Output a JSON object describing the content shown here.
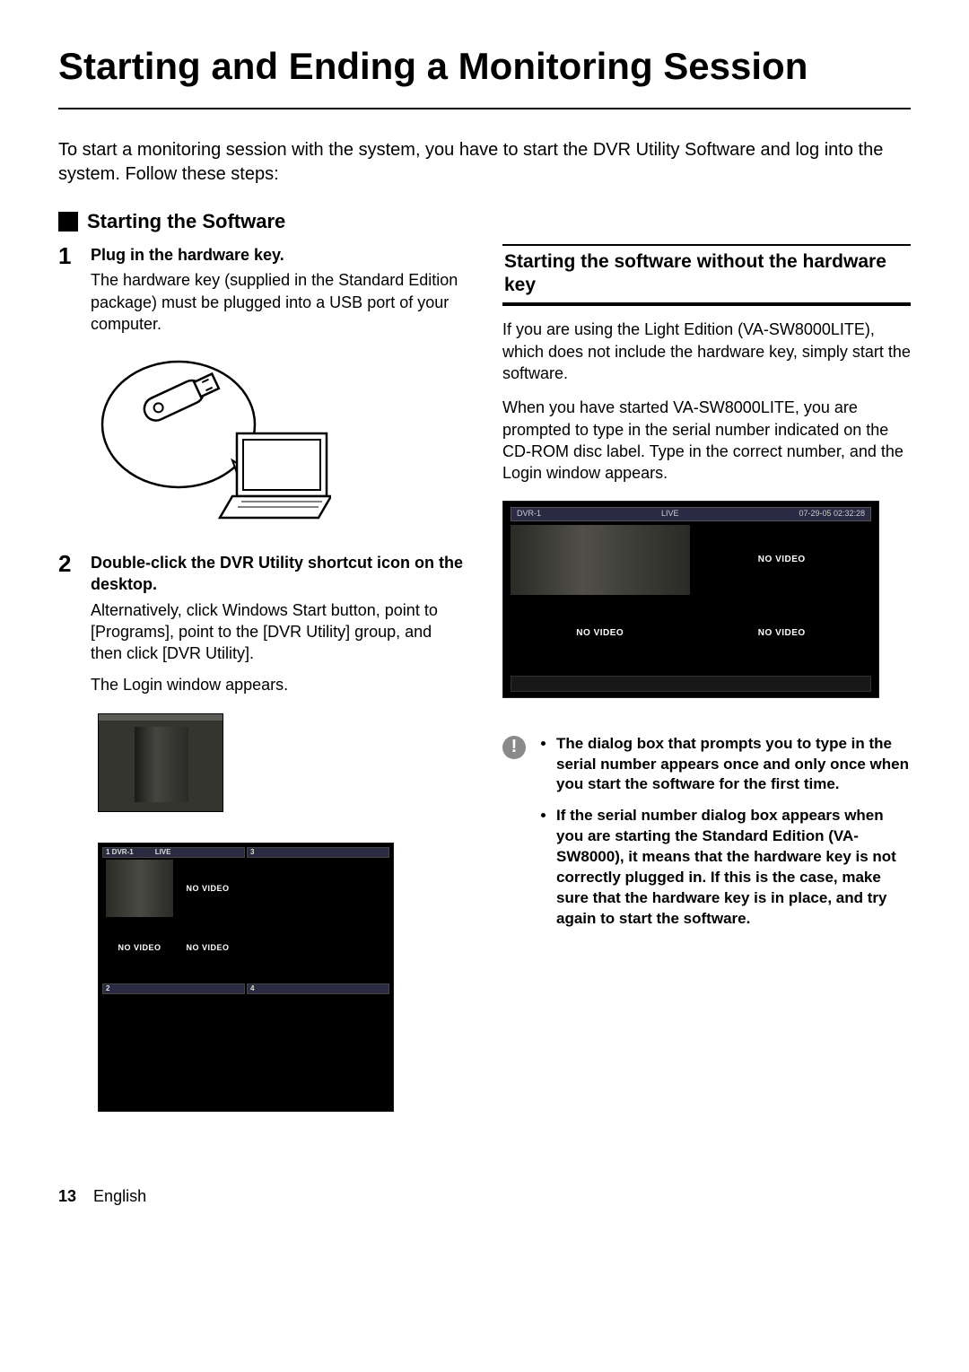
{
  "title": "Starting and Ending a Monitoring Session",
  "intro": "To start a monitoring session with the system, you have to start the DVR Utility Software and log into the system. Follow these steps:",
  "section_heading": "Starting the Software",
  "steps": [
    {
      "num": "1",
      "head": "Plug in the hardware key.",
      "body": "The hardware key (supplied in the Standard Edition package) must be plugged into a USB port of your computer."
    },
    {
      "num": "2",
      "head": "Double-click the DVR Utility shortcut icon on the desktop.",
      "body1": "Alternatively, click Windows Start button, point to [Programs], point to the [DVR Utility] group, and then click [DVR Utility].",
      "body2": "The Login window appears."
    }
  ],
  "quad": {
    "bar1_left": "1  DVR-1",
    "bar1_mid": "LIVE",
    "bar3": "3",
    "bar2": "2",
    "bar4": "4",
    "no_video": "NO VIDEO"
  },
  "sidebox": {
    "heading": "Starting the software without the hardware key",
    "p1": "If you are using the Light Edition (VA-SW8000LITE), which does not include the hardware key, simply start the software.",
    "p2": "When you have started VA-SW8000LITE, you are prompted to type in the serial number indicated on the CD-ROM disc label. Type in the correct number, and the Login window appears."
  },
  "sb_bar": {
    "left": "DVR-1",
    "mid": "LIVE",
    "right": "07-29-05  02:32:28"
  },
  "sb_no_video": "NO VIDEO",
  "alerts": [
    "The dialog box that prompts you to type in the serial number appears once and only once when you start the software for the first time.",
    "If the serial number dialog box appears when you are starting the Standard Edition (VA-SW8000), it means that the hardware key is not correctly plugged in. If this is the case, make sure that the hardware key is in place, and try again to start the software."
  ],
  "footer": {
    "page": "13",
    "lang": "English"
  }
}
